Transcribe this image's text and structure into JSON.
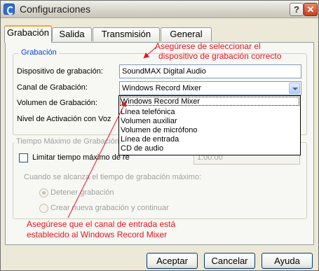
{
  "window": {
    "title": "Configuraciones",
    "help_label": "?",
    "close_label": "✕",
    "app_icon": "app-icon"
  },
  "tabs": [
    {
      "label": "Grabación",
      "active": true
    },
    {
      "label": "Salida",
      "active": false
    },
    {
      "label": "Transmisión",
      "active": false
    },
    {
      "label": "General",
      "active": false
    }
  ],
  "grabacion": {
    "group_title": "Grabación",
    "device_label": "Dispositivo de grabación:",
    "device_value": "SoundMAX Digital Audio",
    "channel_label": "Canal de Grabación:",
    "channel_value": "Windows Record Mixer",
    "volume_label": "Volumen de Grabación:",
    "activation_label": "Nivel de Activación con Voz"
  },
  "dropdown": {
    "options": [
      "Windows Record Mixer",
      "Línea telefónica",
      "Volumen auxiliar",
      "Volumen de micrófono",
      "Línea de entrada",
      "CD de audio"
    ],
    "selected": "Windows Record Mixer"
  },
  "max_time": {
    "group_title": "Tiempo Máximo de Grabación",
    "limit_label": "Limitar tiempo máximo de re",
    "limit_checked": false,
    "time_value": "1:00:00",
    "when_label": "Cuando se alcanza el tiempo de grabación máximo:",
    "radio_stop": "Detener grabación",
    "radio_new": "Crear nueva grabación y continuar",
    "selected_option": "Detener grabación"
  },
  "buttons": {
    "accept": "Aceptar",
    "cancel": "Cancelar",
    "help": "Ayuda"
  },
  "annotations": {
    "top_line1": "Asegúrese de seleccionar el",
    "top_line2": "dispositivo de grabación correcto",
    "bottom_line1": "Asegúrese que el canal de entrada está",
    "bottom_line2": "establecido al Windows Record Mixer",
    "color": "#e8141e"
  }
}
